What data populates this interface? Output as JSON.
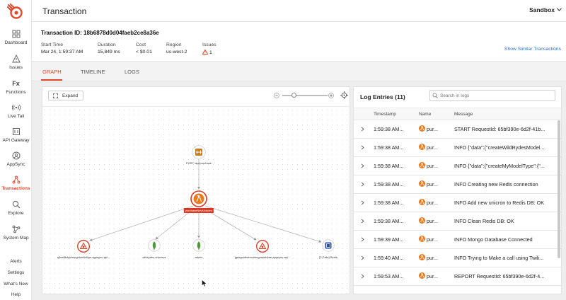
{
  "sidebar": {
    "items": [
      {
        "label": "Dashboard",
        "icon": "dashboard-icon"
      },
      {
        "label": "Issues",
        "icon": "warning-icon"
      },
      {
        "label": "Functions",
        "icon": "function-icon"
      },
      {
        "label": "Live Tail",
        "icon": "live-tail-icon"
      },
      {
        "label": "API Gateway",
        "icon": "api-gateway-icon"
      },
      {
        "label": "AppSync",
        "icon": "appsync-icon"
      },
      {
        "label": "Transactions",
        "icon": "transactions-icon"
      },
      {
        "label": "Explore",
        "icon": "search-icon"
      },
      {
        "label": "System Map",
        "icon": "system-map-icon"
      }
    ],
    "footer": [
      "Alerts",
      "Settings",
      "What's New",
      "Help"
    ],
    "function_glyph": "Fx"
  },
  "header": {
    "title": "Transaction",
    "environment": "Sandbox"
  },
  "transaction": {
    "id_label": "Transaction ID: 18b6878d0d04faeb2ce8a36e",
    "start_time_label": "Start Time",
    "start_time": "Mar 24, 1:59:37 AM",
    "duration_label": "Duration",
    "duration": "15,849 ms",
    "cost_label": "Cost",
    "cost": "< $0.01",
    "region_label": "Region",
    "region": "us-west-2",
    "issues_label": "Issues",
    "issues": "1",
    "similar_link": "Show Similar Transactions"
  },
  "tabs": [
    "GRAPH",
    "TIMELINE",
    "LOGS"
  ],
  "graph": {
    "expand_label": "Expand",
    "nodes": {
      "api": "POST /api/purchase",
      "lambda": "purchaseNewUnicorn",
      "appsync1": "q3ea8kdyhbwcgvfnn6ld4pe.appsync-api...",
      "mongo1": "wildrydes.unicorns",
      "mongo2": "admin",
      "appsync2": "jgeegctdbebnxhtmgrwsah6ae.appsync-api...",
      "redis": "[3 Calls] Redis"
    }
  },
  "logs": {
    "title": "Log Entries (11)",
    "search_placeholder": "Search in logs",
    "columns": {
      "timestamp": "Timestamp",
      "name": "Name",
      "message": "Message"
    },
    "rows": [
      {
        "ts": "1:59:38 AM...",
        "name": "pur...",
        "msg": "START RequestId: 65bf390e-6d2f-41b..."
      },
      {
        "ts": "1:59:38 AM...",
        "name": "pur...",
        "msg": "INFO {\"data\":{\"createWildRydesModel..."
      },
      {
        "ts": "1:59:38 AM...",
        "name": "pur...",
        "msg": "INFO {\"data\":{\"createMyModelType\":{\"..."
      },
      {
        "ts": "1:59:38 AM...",
        "name": "pur...",
        "msg": "INFO Creating new Redis connection"
      },
      {
        "ts": "1:59:38 AM...",
        "name": "pur...",
        "msg": "INFO Add new unicron to Redis DB: OK"
      },
      {
        "ts": "1:59:38 AM...",
        "name": "pur...",
        "msg": "INFO Clean Redis DB: OK"
      },
      {
        "ts": "1:59:39 AM...",
        "name": "pur...",
        "msg": "INFO Mongo Database Connected"
      },
      {
        "ts": "1:59:40 AM...",
        "name": "pur...",
        "msg": "INFO Trying to Make a call using Twili..."
      },
      {
        "ts": "1:59:53 AM...",
        "name": "pur...",
        "msg": "REPORT RequestId: 65bf390e-6d2f-4..."
      }
    ]
  },
  "colors": {
    "accent": "#e2462c",
    "link": "#2d6fc7",
    "mongo": "#4a9a3a",
    "redis": "#2b4fa3"
  }
}
